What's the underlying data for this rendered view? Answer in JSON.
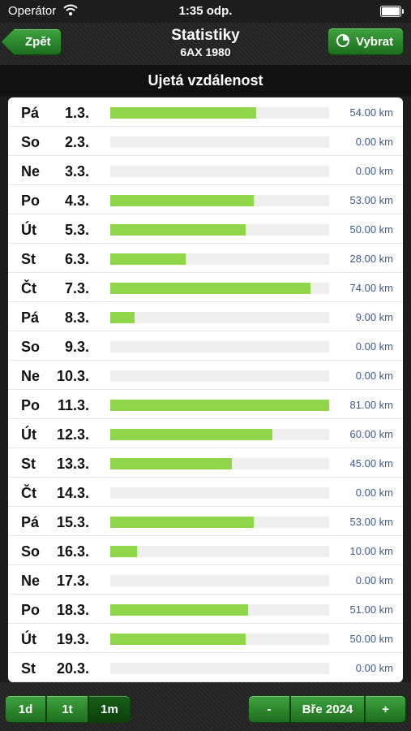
{
  "status": {
    "carrier": "Operátor",
    "time": "1:35 odp."
  },
  "nav": {
    "back_label": "Zpět",
    "title": "Statistiky",
    "subtitle": "6AX 1980",
    "select_label": "Vybrat"
  },
  "section_title": "Ujetá vzdálenost",
  "max_value": 81,
  "rows": [
    {
      "day": "Pá",
      "date": "1.3.",
      "value": 54,
      "label": "54.00 km"
    },
    {
      "day": "So",
      "date": "2.3.",
      "value": 0,
      "label": "0.00 km"
    },
    {
      "day": "Ne",
      "date": "3.3.",
      "value": 0,
      "label": "0.00 km"
    },
    {
      "day": "Po",
      "date": "4.3.",
      "value": 53,
      "label": "53.00 km"
    },
    {
      "day": "Út",
      "date": "5.3.",
      "value": 50,
      "label": "50.00 km"
    },
    {
      "day": "St",
      "date": "6.3.",
      "value": 28,
      "label": "28.00 km"
    },
    {
      "day": "Čt",
      "date": "7.3.",
      "value": 74,
      "label": "74.00 km"
    },
    {
      "day": "Pá",
      "date": "8.3.",
      "value": 9,
      "label": "9.00 km"
    },
    {
      "day": "So",
      "date": "9.3.",
      "value": 0,
      "label": "0.00 km"
    },
    {
      "day": "Ne",
      "date": "10.3.",
      "value": 0,
      "label": "0.00 km"
    },
    {
      "day": "Po",
      "date": "11.3.",
      "value": 81,
      "label": "81.00 km"
    },
    {
      "day": "Út",
      "date": "12.3.",
      "value": 60,
      "label": "60.00 km"
    },
    {
      "day": "St",
      "date": "13.3.",
      "value": 45,
      "label": "45.00 km"
    },
    {
      "day": "Čt",
      "date": "14.3.",
      "value": 0,
      "label": "0.00 km"
    },
    {
      "day": "Pá",
      "date": "15.3.",
      "value": 53,
      "label": "53.00 km"
    },
    {
      "day": "So",
      "date": "16.3.",
      "value": 10,
      "label": "10.00 km"
    },
    {
      "day": "Ne",
      "date": "17.3.",
      "value": 0,
      "label": "0.00 km"
    },
    {
      "day": "Po",
      "date": "18.3.",
      "value": 51,
      "label": "51.00 km"
    },
    {
      "day": "Út",
      "date": "19.3.",
      "value": 50,
      "label": "50.00 km"
    },
    {
      "day": "St",
      "date": "20.3.",
      "value": 0,
      "label": "0.00 km"
    }
  ],
  "bottom": {
    "period_1d": "1d",
    "period_1t": "1t",
    "period_1m": "1m",
    "selected_period": "1m",
    "prev_label": "-",
    "month_label": "Bře 2024",
    "next_label": "+"
  },
  "colors": {
    "bar": "#8fd64a",
    "track": "#efefef",
    "button": "#2b8a2b",
    "value_text": "#3d5a8a"
  }
}
